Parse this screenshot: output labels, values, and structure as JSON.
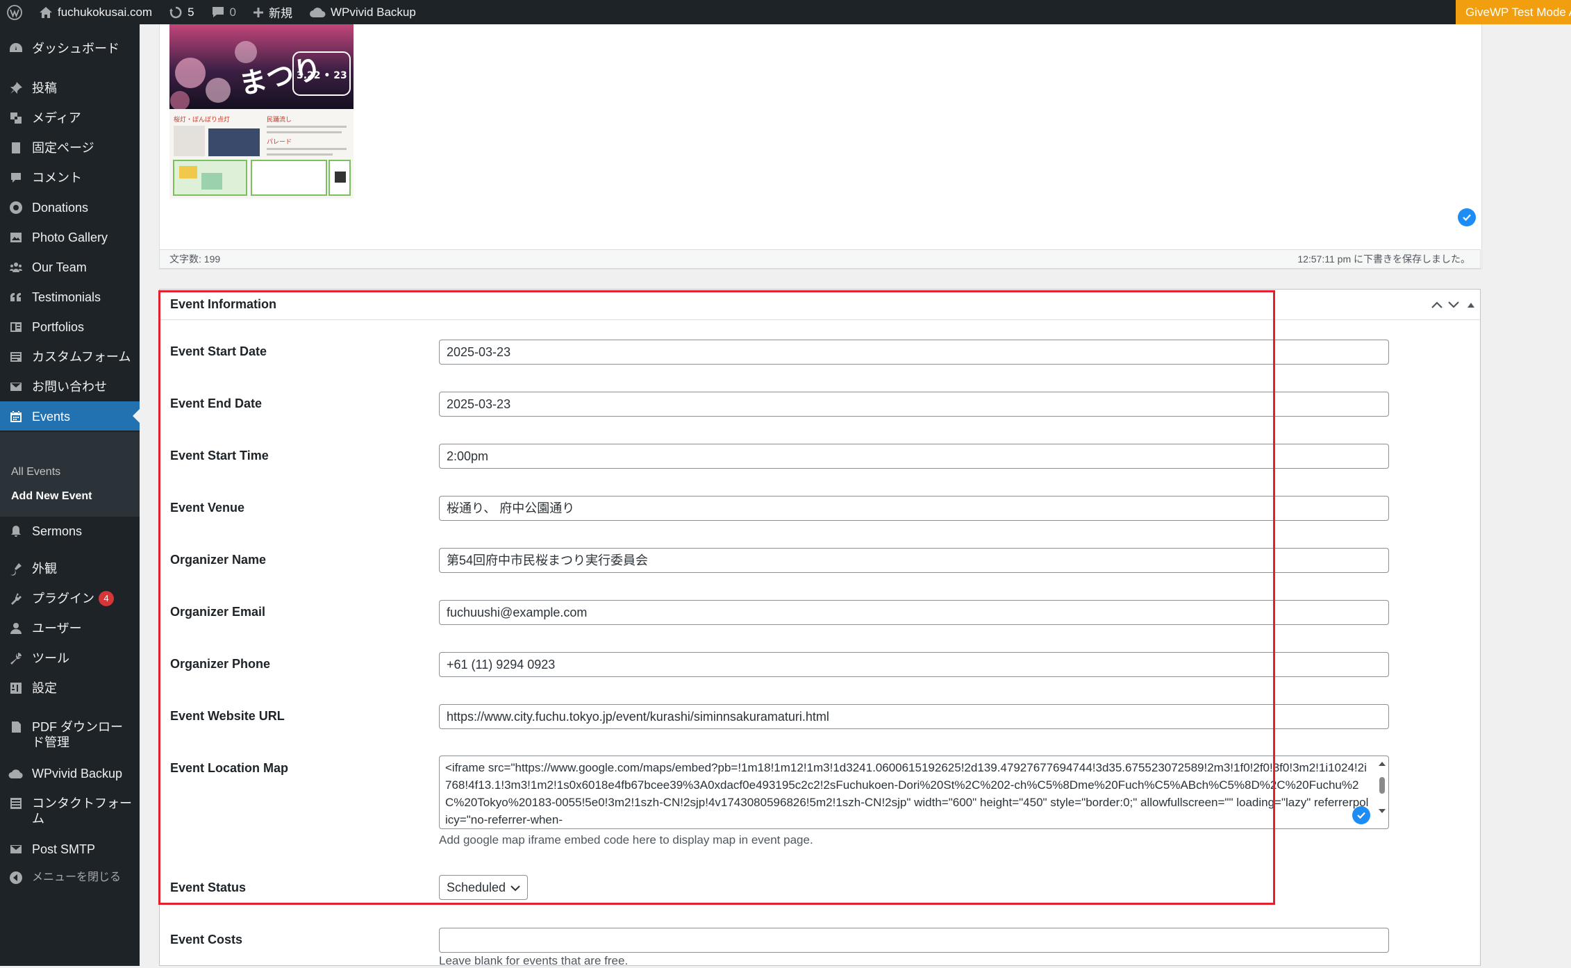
{
  "adminbar": {
    "site_name": "fuchukokusai.com",
    "updates_count": "5",
    "comments_count": "0",
    "new_label": "新規",
    "wpvivid_label": "WPvivid Backup",
    "givewp_badge": "GiveWP Test Mode Active"
  },
  "sidebar": {
    "items": [
      {
        "label": "ダッシュボード",
        "icon": "dashboard-icon"
      },
      {
        "label": "投稿",
        "icon": "pin-icon"
      },
      {
        "label": "メディア",
        "icon": "media-icon"
      },
      {
        "label": "固定ページ",
        "icon": "page-icon"
      },
      {
        "label": "コメント",
        "icon": "comment-icon"
      },
      {
        "label": "Donations",
        "icon": "donations-icon"
      },
      {
        "label": "Photo Gallery",
        "icon": "gallery-icon"
      },
      {
        "label": "Our Team",
        "icon": "team-icon"
      },
      {
        "label": "Testimonials",
        "icon": "quote-icon"
      },
      {
        "label": "Portfolios",
        "icon": "portfolio-icon"
      },
      {
        "label": "カスタムフォーム",
        "icon": "form-icon"
      },
      {
        "label": "お問い合わせ",
        "icon": "mail-icon"
      },
      {
        "label": "Events",
        "icon": "calendar-icon"
      },
      {
        "label": "Sermons",
        "icon": "bell-icon"
      },
      {
        "label": "外観",
        "icon": "brush-icon"
      },
      {
        "label": "プラグイン",
        "icon": "plugin-icon",
        "badge": "4"
      },
      {
        "label": "ユーザー",
        "icon": "user-icon"
      },
      {
        "label": "ツール",
        "icon": "wrench-icon"
      },
      {
        "label": "設定",
        "icon": "settings-icon"
      },
      {
        "label": "PDF ダウンロード管理",
        "icon": "pdf-icon"
      },
      {
        "label": "WPvivid Backup",
        "icon": "cloud-icon"
      },
      {
        "label": "コンタクトフォーム",
        "icon": "list-icon"
      },
      {
        "label": "Post SMTP",
        "icon": "envelope-icon"
      },
      {
        "label": "メニューを閉じる",
        "icon": "collapse-icon"
      }
    ],
    "submenu": {
      "all_events": "All Events",
      "add_new_event": "Add New Event"
    }
  },
  "editor": {
    "word_count": "文字数: 199",
    "autosave": "12:57:11 pm に下書きを保存しました。",
    "poster": {
      "title_glyphs": "まつり",
      "dates": "3.22 • 23",
      "sections": [
        "桜灯・ぼんぼり点灯",
        "民踊流し",
        "パレード"
      ]
    }
  },
  "metabox": {
    "title": "Event Information",
    "fields": [
      {
        "label": "Event Start Date",
        "value": "2025-03-23"
      },
      {
        "label": "Event End Date",
        "value": "2025-03-23"
      },
      {
        "label": "Event Start Time",
        "value": "2:00pm"
      },
      {
        "label": "Event Venue",
        "value": "桜通り、 府中公園通り"
      },
      {
        "label": "Organizer Name",
        "value": "第54回府中市民桜まつり実行委員会"
      },
      {
        "label": "Organizer Email",
        "value": "fuchuushi@example.com"
      },
      {
        "label": "Organizer Phone",
        "value": "+61 (11) 9294 0923"
      },
      {
        "label": "Event Website URL",
        "value": "https://www.city.fuchu.tokyo.jp/event/kurashi/siminnsakuramaturi.html"
      }
    ],
    "map": {
      "label": "Event Location Map",
      "value": "<iframe src=\"https://www.google.com/maps/embed?pb=!1m18!1m12!1m3!1d3241.0600615192625!2d139.47927677694744!3d35.675523072589!2m3!1f0!2f0!3f0!3m2!1i1024!2i768!4f13.1!3m3!1m2!1s0x6018e4fb67bcee39%3A0xdacf0e493195c2c2!2sFuchukoen-Dori%20St%2C%202-ch%C5%8Dme%20Fuch%C5%ABch%C5%8D%2C%20Fuchu%2C%20Tokyo%20183-0055!5e0!3m2!1szh-CN!2sjp!4v1743080596826!5m2!1szh-CN!2sjp\" width=\"600\" height=\"450\" style=\"border:0;\" allowfullscreen=\"\" loading=\"lazy\" referrerpolicy=\"no-referrer-when-",
      "help": "Add google map iframe embed code here to display map in event page."
    },
    "status": {
      "label": "Event Status",
      "value": "Scheduled"
    },
    "costs": {
      "label": "Event Costs",
      "value": "",
      "help": "Leave blank for events that are free."
    }
  },
  "colors": {
    "adminbar_bg": "#1d2327",
    "sidebar_active": "#2271b1",
    "highlight_border": "#e3202e",
    "givewp_badge": "#f29f0f",
    "plugin_badge": "#d63638"
  }
}
